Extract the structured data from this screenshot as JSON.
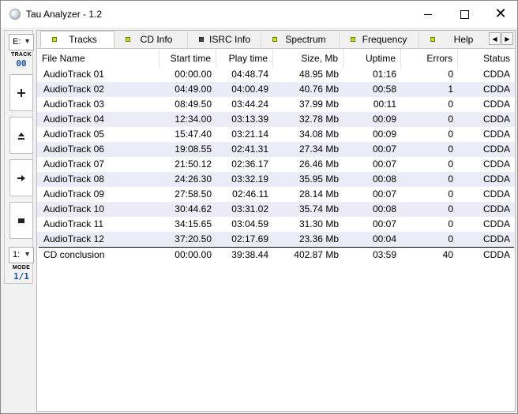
{
  "window": {
    "title": "Tau Analyzer - 1.2"
  },
  "left_panel": {
    "drive_value": "E:",
    "track_label": "TRACK",
    "track_value": "00",
    "mode_combo_value": "1:",
    "mode_label": "MODE",
    "mode_value": "1/1",
    "buttons": [
      "plus-icon",
      "eject-icon",
      "arrow-right-icon",
      "stop-icon"
    ]
  },
  "tabs": [
    {
      "label": "Tracks",
      "flag": "yellow",
      "active": true
    },
    {
      "label": "CD Info",
      "flag": "yellow",
      "active": false
    },
    {
      "label": "ISRC Info",
      "flag": "grey",
      "active": false
    },
    {
      "label": "Spectrum",
      "flag": "yellow",
      "active": false
    },
    {
      "label": "Frequency",
      "flag": "yellow",
      "active": false
    },
    {
      "label": "Help",
      "flag": "yellow",
      "active": false
    }
  ],
  "columns": [
    "File Name",
    "Start time",
    "Play time",
    "Size, Mb",
    "Uptime",
    "Errors",
    "Status"
  ],
  "rows": [
    [
      "AudioTrack 01",
      "00:00.00",
      "04:48.74",
      "48.95 Mb",
      "01:16",
      "0",
      "CDDA"
    ],
    [
      "AudioTrack 02",
      "04:49.00",
      "04:00.49",
      "40.76 Mb",
      "00:58",
      "1",
      "CDDA"
    ],
    [
      "AudioTrack 03",
      "08:49.50",
      "03:44.24",
      "37.99 Mb",
      "00:11",
      "0",
      "CDDA"
    ],
    [
      "AudioTrack 04",
      "12:34.00",
      "03:13.39",
      "32.78 Mb",
      "00:09",
      "0",
      "CDDA"
    ],
    [
      "AudioTrack 05",
      "15:47.40",
      "03:21.14",
      "34.08 Mb",
      "00:09",
      "0",
      "CDDA"
    ],
    [
      "AudioTrack 06",
      "19:08.55",
      "02:41.31",
      "27.34 Mb",
      "00:07",
      "0",
      "CDDA"
    ],
    [
      "AudioTrack 07",
      "21:50.12",
      "02:36.17",
      "26.46 Mb",
      "00:07",
      "0",
      "CDDA"
    ],
    [
      "AudioTrack 08",
      "24:26.30",
      "03:32.19",
      "35.95 Mb",
      "00:08",
      "0",
      "CDDA"
    ],
    [
      "AudioTrack 09",
      "27:58.50",
      "02:46.11",
      "28.14 Mb",
      "00:07",
      "0",
      "CDDA"
    ],
    [
      "AudioTrack 10",
      "30:44.62",
      "03:31.02",
      "35.74 Mb",
      "00:08",
      "0",
      "CDDA"
    ],
    [
      "AudioTrack 11",
      "34:15.65",
      "03:04.59",
      "31.30 Mb",
      "00:07",
      "0",
      "CDDA"
    ],
    [
      "AudioTrack 12",
      "37:20.50",
      "02:17.69",
      "23.36 Mb",
      "00:04",
      "0",
      "CDDA"
    ]
  ],
  "summary": [
    "CD conclusion",
    "00:00.00",
    "39:38.44",
    "402.87 Mb",
    "03:59",
    "40",
    "CDDA"
  ],
  "colors": {
    "alt_row": "#ececf8",
    "track_value": "#1450a0",
    "flag_yellow": "#c9e60a"
  }
}
